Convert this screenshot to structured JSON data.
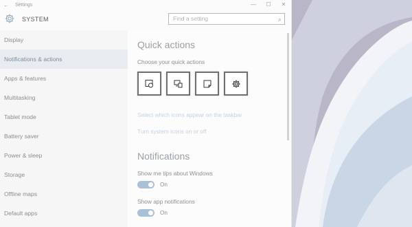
{
  "window": {
    "title": "Settings",
    "back_glyph": "←",
    "controls": {
      "minimize": "—",
      "maximize": "☐",
      "close": "✕"
    }
  },
  "header": {
    "section_title": "SYSTEM",
    "search": {
      "placeholder": "Find a setting",
      "icon": "search-icon"
    }
  },
  "sidebar": {
    "items": [
      {
        "label": "Display",
        "active": false
      },
      {
        "label": "Notifications & actions",
        "active": true
      },
      {
        "label": "Apps & features",
        "active": false
      },
      {
        "label": "Multitasking",
        "active": false
      },
      {
        "label": "Tablet mode",
        "active": false
      },
      {
        "label": "Battery saver",
        "active": false
      },
      {
        "label": "Power & sleep",
        "active": false
      },
      {
        "label": "Storage",
        "active": false
      },
      {
        "label": "Offline maps",
        "active": false
      },
      {
        "label": "Default apps",
        "active": false
      }
    ]
  },
  "main": {
    "quick_actions": {
      "heading": "Quick actions",
      "subheading": "Choose your quick actions",
      "tiles": [
        {
          "icon": "tablet-mode-icon"
        },
        {
          "icon": "connect-icon"
        },
        {
          "icon": "note-icon"
        },
        {
          "icon": "settings-gear-icon"
        }
      ],
      "link_taskbar_icons": "Select which icons appear on the taskbar",
      "link_system_icons": "Turn system icons on or off"
    },
    "notifications": {
      "heading": "Notifications",
      "tips": {
        "label": "Show me tips about Windows",
        "state": "On",
        "on": true
      },
      "app_notifications": {
        "label": "Show app notifications",
        "state": "On",
        "on": true
      }
    }
  },
  "colors": {
    "accent": "#a9c1d8",
    "link": "#c3d2e2",
    "active_nav_bg": "#e8ecf1"
  }
}
